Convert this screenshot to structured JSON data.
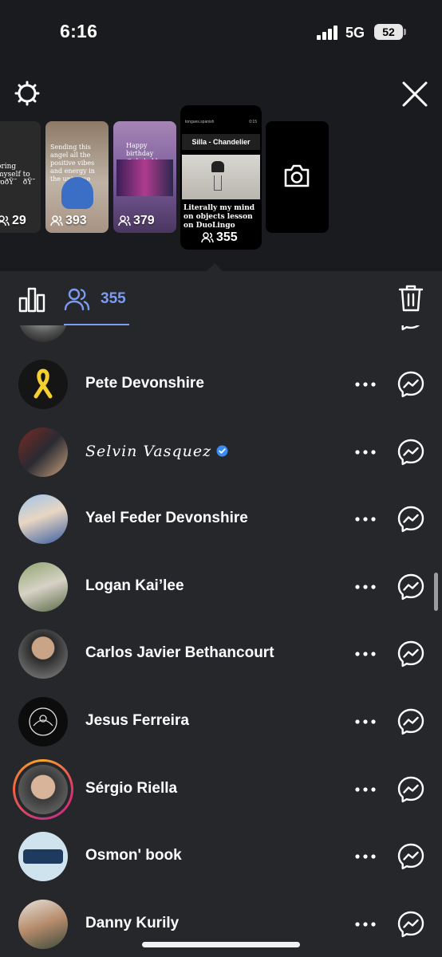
{
  "status_bar": {
    "time": "6:16",
    "network": "5G",
    "battery": "52"
  },
  "stories": [
    {
      "caption": "oring myself to roðŸ˜ðŸ˜",
      "viewers": "29"
    },
    {
      "caption": "Sending this angel all the positive vibes and energy in the universe",
      "viewers": "393"
    },
    {
      "caption": "Happy birthday @chakakhan",
      "viewers": "379"
    },
    {
      "header_left": "tongues.spanish",
      "header_right": "0:15",
      "banner": "Silla - Chandelier",
      "caption": "Literally my mind on objects lesson on DuoLingo",
      "viewers": "355"
    },
    {
      "icon": "camera-icon"
    }
  ],
  "sheet": {
    "viewer_count": "355",
    "accent": "#7b9cf2"
  },
  "viewers": [
    {
      "name": ""
    },
    {
      "name": "Pete Devonshire",
      "avatar_text": "BRING THEM HOME NOW!"
    },
    {
      "name": "𝒮𝑒𝓁𝓋𝒾𝓃 𝒱𝒶𝓈𝓆𝓊𝑒𝓏",
      "verified": true
    },
    {
      "name": "Yael Feder Devonshire"
    },
    {
      "name": "Logan Kai’lee"
    },
    {
      "name": "Carlos Javier Bethancourt"
    },
    {
      "name": "Jesus Ferreira"
    },
    {
      "name": "Sérgio Riella",
      "story_ring": true
    },
    {
      "name": "Osmon' book",
      "avatar_text": "OSMON'S BOOK"
    },
    {
      "name": "Danny Kurily"
    }
  ]
}
